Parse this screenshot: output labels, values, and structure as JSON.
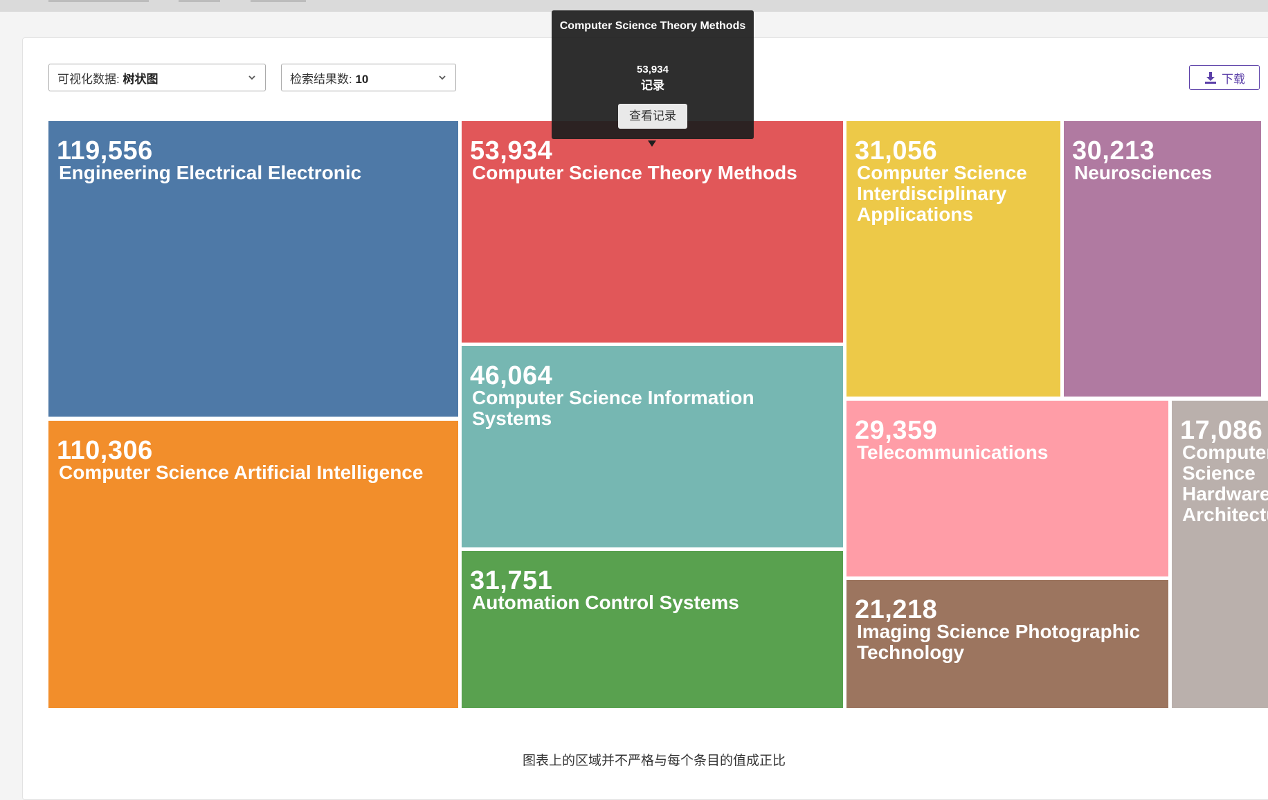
{
  "toolbar": {
    "visualization_label": "可视化数据:",
    "visualization_value": "树状图",
    "result_count_label": "检索结果数:",
    "result_count_value": "10",
    "download_label": "下载"
  },
  "tooltip": {
    "title": "Computer Science Theory Methods",
    "count": "53,934",
    "unit": "记录",
    "button": "查看记录"
  },
  "footnote": "图表上的区域并不严格与每个条目的值成正比",
  "chart_data": {
    "type": "treemap",
    "items": [
      {
        "name": "Engineering Electrical Electronic",
        "value": 119556,
        "label": "119,556",
        "color": "#4e79a7"
      },
      {
        "name": "Computer Science Artificial Intelligence",
        "value": 110306,
        "label": "110,306",
        "color": "#f28e2b"
      },
      {
        "name": "Computer Science Theory Methods",
        "value": 53934,
        "label": "53,934",
        "color": "#e15759"
      },
      {
        "name": "Computer Science Information Systems",
        "value": 46064,
        "label": "46,064",
        "color": "#76b7b2"
      },
      {
        "name": "Automation Control Systems",
        "value": 31751,
        "label": "31,751",
        "color": "#59a14f"
      },
      {
        "name": "Computer Science Interdisciplinary Applications",
        "value": 31056,
        "label": "31,056",
        "color": "#edc948"
      },
      {
        "name": "Neurosciences",
        "value": 30213,
        "label": "30,213",
        "color": "#b07aa1"
      },
      {
        "name": "Telecommunications",
        "value": 29359,
        "label": "29,359",
        "color": "#ff9da7"
      },
      {
        "name": "Imaging Science Photographic Technology",
        "value": 21218,
        "label": "21,218",
        "color": "#9c755f"
      },
      {
        "name": "Computer Science Hardware Architecture",
        "value": 17086,
        "label": "17,086",
        "color": "#bab0ac"
      }
    ]
  }
}
